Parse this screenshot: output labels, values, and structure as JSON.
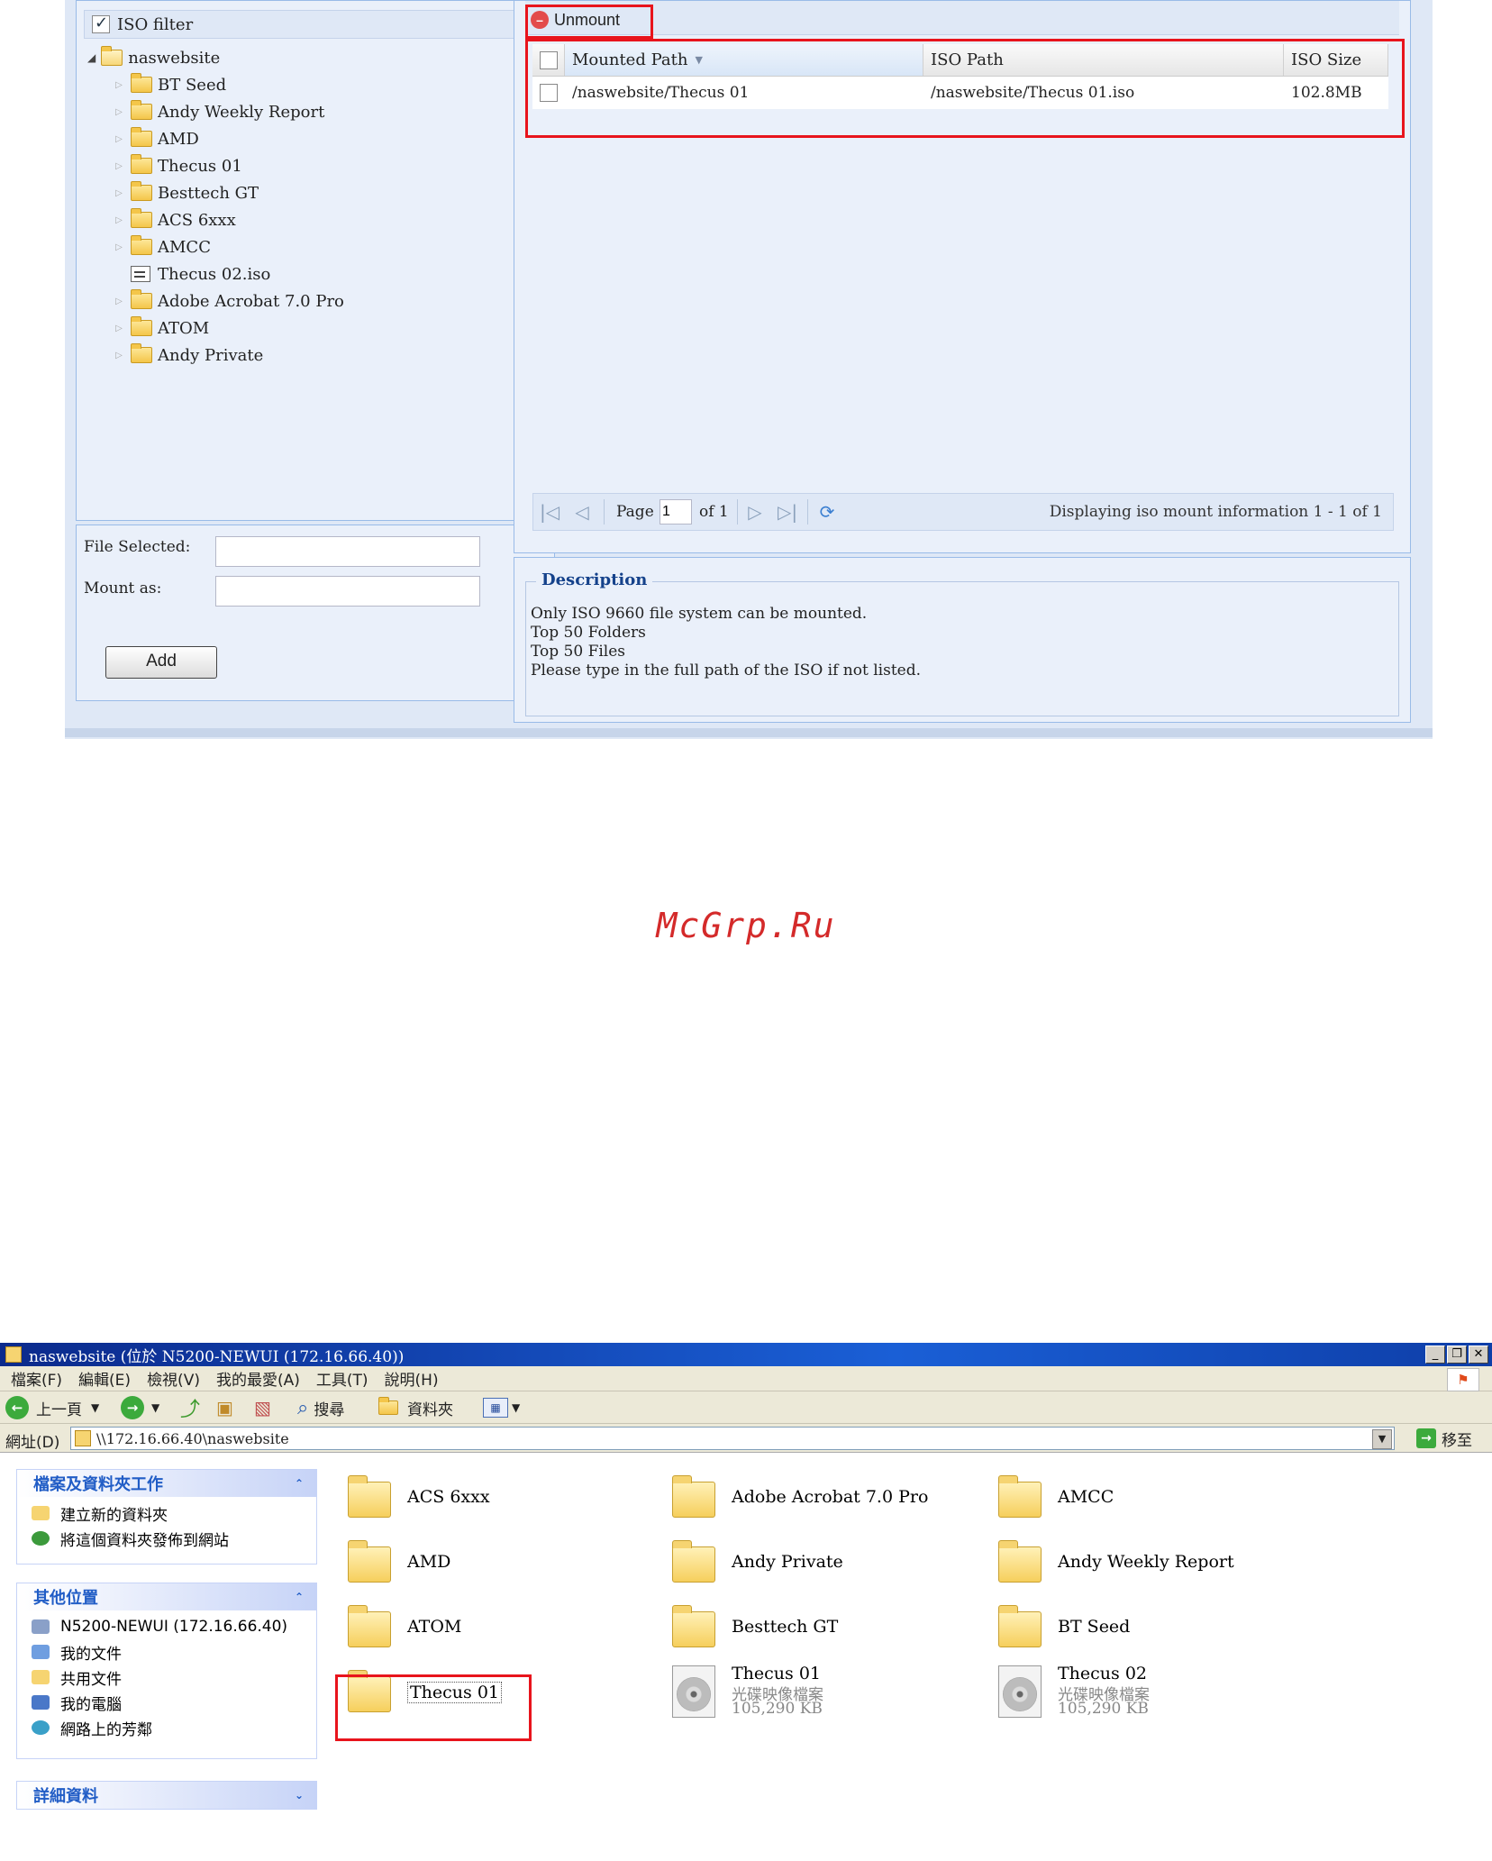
{
  "iso_mount": {
    "tree": {
      "filter_label": "ISO filter",
      "root": "naswebsite",
      "items": [
        {
          "label": "BT Seed",
          "type": "folder"
        },
        {
          "label": "Andy Weekly Report",
          "type": "folder"
        },
        {
          "label": "AMD",
          "type": "folder"
        },
        {
          "label": "Thecus 01",
          "type": "folder"
        },
        {
          "label": "Besttech GT",
          "type": "folder"
        },
        {
          "label": "ACS 6xxx",
          "type": "folder"
        },
        {
          "label": "AMCC",
          "type": "folder"
        },
        {
          "label": "Thecus 02.iso",
          "type": "iso"
        },
        {
          "label": "Adobe Acrobat 7.0 Pro",
          "type": "folder"
        },
        {
          "label": "ATOM",
          "type": "folder"
        },
        {
          "label": "Andy Private",
          "type": "folder"
        }
      ]
    },
    "form": {
      "file_selected_label": "File Selected:",
      "file_selected_value": "",
      "mount_as_label": "Mount as:",
      "mount_as_value": "",
      "add_button": "Add"
    },
    "toolbar": {
      "unmount_label": "Unmount"
    },
    "grid": {
      "columns": [
        "Mounted Path",
        "ISO Path",
        "ISO Size"
      ],
      "rows": [
        {
          "mounted_path": "/naswebsite/Thecus 01",
          "iso_path": "/naswebsite/Thecus 01.iso",
          "iso_size": "102.8MB"
        }
      ]
    },
    "pager": {
      "page_label": "Page",
      "page_value": "1",
      "of_label": "of 1",
      "display_text": "Displaying iso mount information 1 - 1 of 1"
    },
    "description": {
      "legend": "Description",
      "lines": [
        "Only ISO 9660 file system can be mounted.",
        "Top 50 Folders",
        "Top 50 Files",
        "Please type in the full path of the ISO if not listed."
      ]
    }
  },
  "watermark": "McGrp.Ru",
  "explorer": {
    "title": "naswebsite (位於 N5200-NEWUI (172.16.66.40))",
    "menu": [
      "檔案(F)",
      "編輯(E)",
      "檢視(V)",
      "我的最愛(A)",
      "工具(T)",
      "說明(H)"
    ],
    "toolbar": {
      "back": "上一頁",
      "search": "搜尋",
      "folders": "資料夾"
    },
    "address": {
      "label": "網址(D)",
      "value": "\\\\172.16.66.40\\naswebsite",
      "go": "移至"
    },
    "tasks": {
      "file_tasks_title": "檔案及資料夾工作",
      "file_tasks": [
        "建立新的資料夾",
        "將這個資料夾發佈到網站"
      ],
      "other_places_title": "其他位置",
      "other_places": [
        "N5200-NEWUI (172.16.66.40)",
        "我的文件",
        "共用文件",
        "我的電腦",
        "網路上的芳鄰"
      ],
      "details_title": "詳細資料"
    },
    "items": [
      {
        "name": "ACS 6xxx",
        "type": "folder"
      },
      {
        "name": "Adobe Acrobat 7.0 Pro",
        "type": "folder"
      },
      {
        "name": "AMCC",
        "type": "folder"
      },
      {
        "name": "AMD",
        "type": "folder"
      },
      {
        "name": "Andy Private",
        "type": "folder"
      },
      {
        "name": "Andy Weekly Report",
        "type": "folder"
      },
      {
        "name": "ATOM",
        "type": "folder"
      },
      {
        "name": "Besttech GT",
        "type": "folder"
      },
      {
        "name": "BT Seed",
        "type": "folder"
      },
      {
        "name": "Thecus 01",
        "type": "folder"
      },
      {
        "name": "Thecus 01",
        "type": "iso",
        "kind": "光碟映像檔案",
        "size": "105,290 KB"
      },
      {
        "name": "Thecus 02",
        "type": "iso",
        "kind": "光碟映像檔案",
        "size": "105,290 KB"
      }
    ]
  }
}
